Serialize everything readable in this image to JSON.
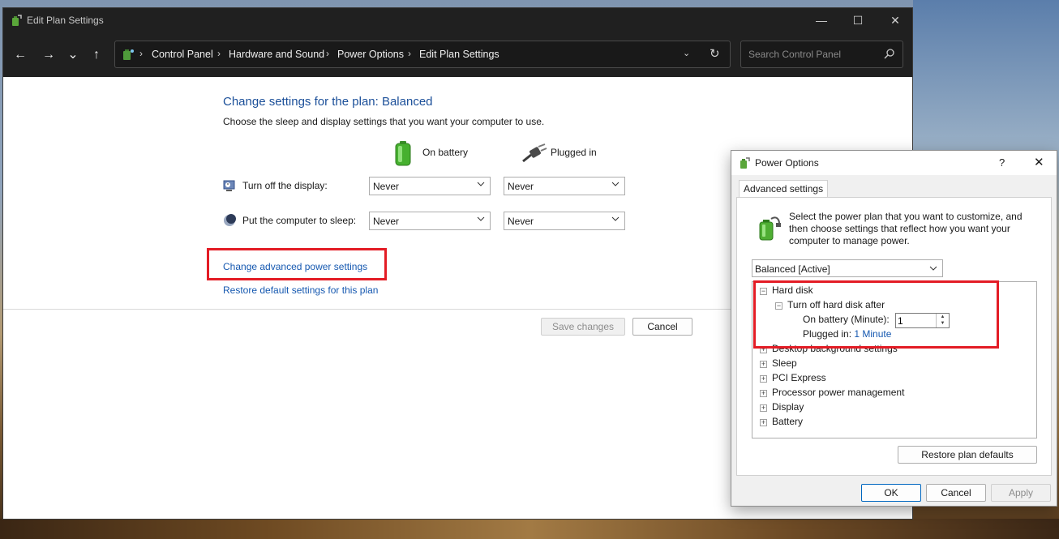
{
  "main_window": {
    "title": "Edit Plan Settings",
    "controls": {
      "minimize": "—",
      "maximize": "☐",
      "close": "✕"
    },
    "nav": {
      "back": "←",
      "forward": "→",
      "recent": "⌄",
      "up": "↑"
    },
    "breadcrumb": [
      "Control Panel",
      "Hardware and Sound",
      "Power Options",
      "Edit Plan Settings"
    ],
    "search_placeholder": "Search Control Panel",
    "heading": "Change settings for the plan: Balanced",
    "subtext": "Choose the sleep and display settings that you want your computer to use.",
    "columns": {
      "battery": "On battery",
      "plugged": "Plugged in"
    },
    "rows": [
      {
        "label": "Turn off the display:",
        "battery": "Never",
        "plugged": "Never"
      },
      {
        "label": "Put the computer to sleep:",
        "battery": "Never",
        "plugged": "Never"
      }
    ],
    "links": {
      "advanced": "Change advanced power settings",
      "restore": "Restore default settings for this plan"
    },
    "buttons": {
      "save": "Save changes",
      "cancel": "Cancel"
    }
  },
  "dialog": {
    "title": "Power Options",
    "help": "?",
    "close": "✕",
    "tab": "Advanced settings",
    "description": "Select the power plan that you want to customize, and then choose settings that reflect how you want your computer to manage power.",
    "plan": "Balanced [Active]",
    "tree": {
      "hard_disk": "Hard disk",
      "turn_off": "Turn off hard disk after",
      "on_battery_label": "On battery (Minute):",
      "on_battery_value": "1",
      "plugged_label": "Plugged in:",
      "plugged_value": "1 Minute",
      "items": [
        "Desktop background settings",
        "Sleep",
        "PCI Express",
        "Processor power management",
        "Display",
        "Battery"
      ]
    },
    "buttons": {
      "restore": "Restore plan defaults",
      "ok": "OK",
      "cancel": "Cancel",
      "apply": "Apply"
    }
  },
  "colors": {
    "highlight_box": "#e31c25",
    "link": "#1558b0",
    "heading": "#1b4f99"
  }
}
